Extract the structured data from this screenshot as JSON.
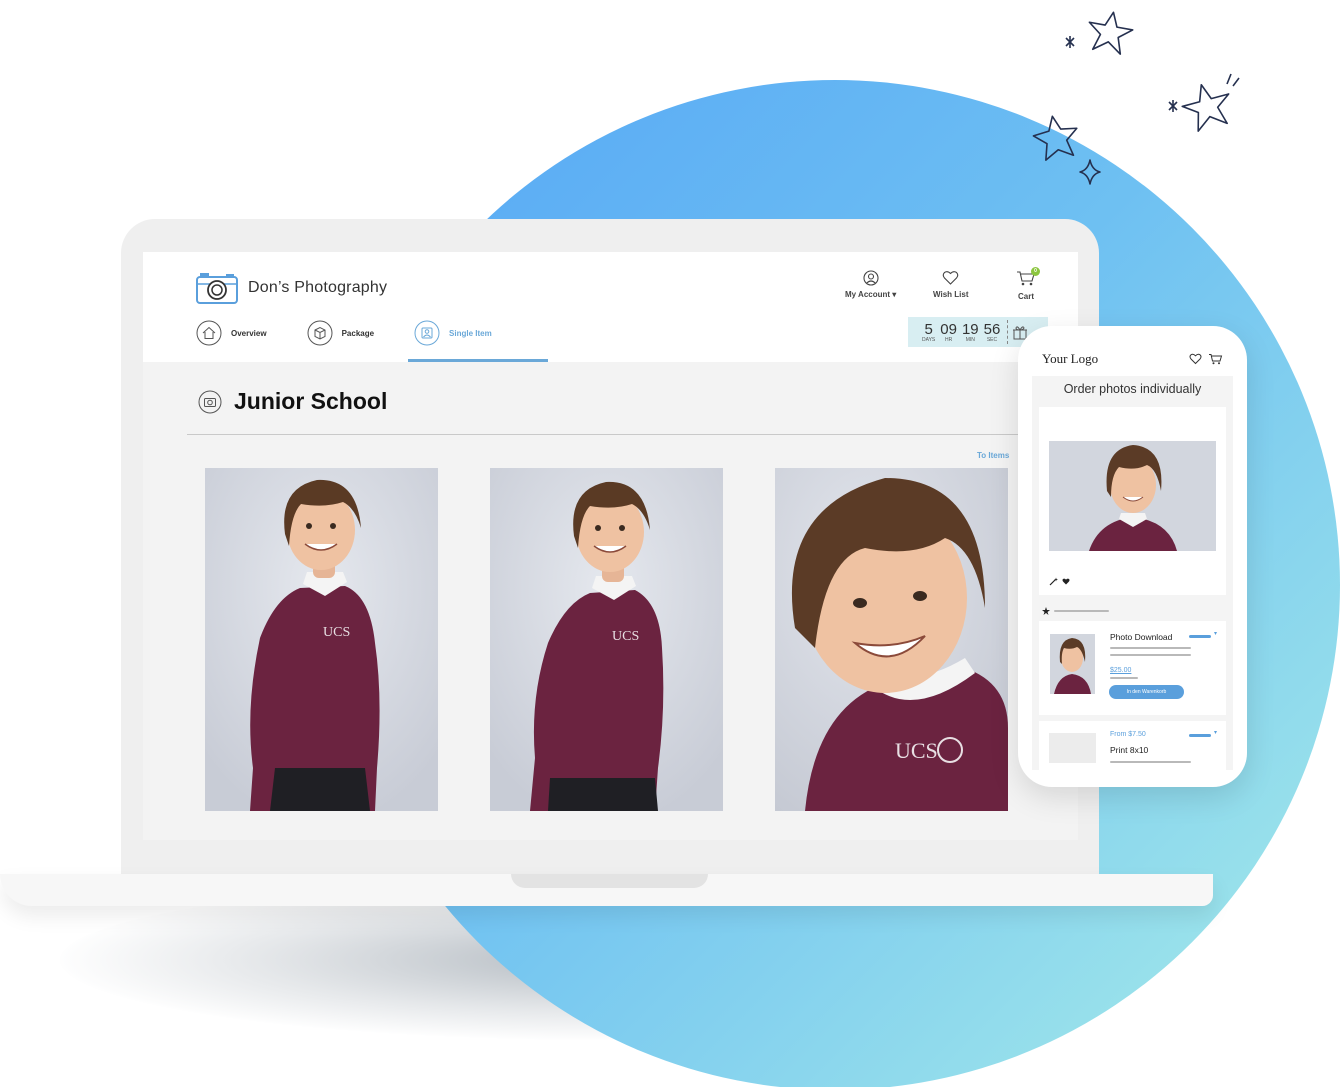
{
  "brand": {
    "name": "Don’s Photography"
  },
  "header_actions": [
    {
      "label": "My Account",
      "icon": "user-circle-icon",
      "dropdown": true
    },
    {
      "label": "Wish List",
      "icon": "heart-icon"
    },
    {
      "label": "Cart",
      "icon": "cart-icon",
      "badge": "0"
    }
  ],
  "nav": [
    {
      "label": "Overview",
      "icon": "home-icon",
      "active": false
    },
    {
      "label": "Package",
      "icon": "box-icon",
      "active": false
    },
    {
      "label": "Single Item",
      "icon": "single-photo-icon",
      "active": true
    }
  ],
  "countdown": {
    "days": "5",
    "days_label": "DAYS",
    "hours": "09",
    "hours_label": "HR",
    "minutes": "19",
    "minutes_label": "MIN",
    "seconds": "56",
    "seconds_label": "SEC",
    "icon": "gift-icon"
  },
  "section": {
    "title": "Junior School",
    "icon": "camera-icon",
    "link": "To Items"
  },
  "photos": [
    {
      "alt": "student-photo-full-body-1"
    },
    {
      "alt": "student-photo-full-body-2"
    },
    {
      "alt": "student-photo-close-up"
    }
  ],
  "phone": {
    "logo": "Your Logo",
    "heading": "Order photos individually",
    "product1": {
      "title": "Photo Download",
      "price": "$25.00",
      "button": "In den Warenkorb"
    },
    "product2": {
      "from_price": "From $7.50",
      "title": "Print 8x10"
    }
  },
  "colors": {
    "accent": "#6aa8d8",
    "phone_accent": "#5a9fdc",
    "circle_start": "#55a6f5",
    "circle_end": "#a7ece8",
    "sweater": "#6b2340"
  }
}
